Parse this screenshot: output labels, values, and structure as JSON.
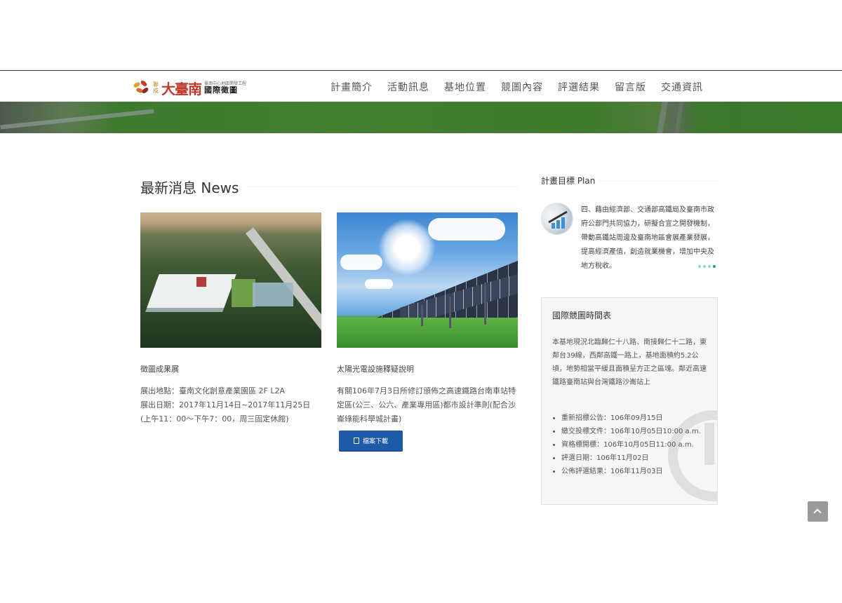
{
  "header": {
    "logo": {
      "side_text": "聯成",
      "big_text": "大臺南",
      "small_text": "臺南中心地區開發工程",
      "intl_text": "國際徵圖"
    },
    "nav": [
      "計畫簡介",
      "活動訊息",
      "基地位置",
      "競圖內容",
      "評選結果",
      "留言版",
      "交通資訊"
    ]
  },
  "news": {
    "title": "最新消息 News",
    "cards": [
      {
        "title": "徵圖成果展",
        "lines": [
          "展出地點：臺南文化創意產業園區 2F L2A",
          "展出日期：2017年11月14日~2017年11月25日",
          "(上午11：00～下午7：00，周三固定休館)"
        ]
      },
      {
        "title": "太陽光電設施釋疑說明",
        "text": "有關106年7月3日所修訂頒佈之高速鐵路台南車站特定區(公三、公六、產業專用區)都市設計準則(配合沙崙綠能科學城計畫)",
        "button": "檔案下載"
      }
    ]
  },
  "plan": {
    "title": "計畫目標 Plan",
    "text": "四、藉由經濟部、交通部高鐵局及臺南市政府公部門共同協力，研擬合宜之開發機制，帶動高鐵站周邊及臺南地區會展產業發展，提高經濟產值，創造就業機會，增加中央及地方稅收。"
  },
  "schedule": {
    "title": "國際競圖時間表",
    "description": "本基地現況北臨歸仁十八路、南接歸仁十二路，東鄰台39線，西鄰高鐵一路上，基地面積約5.2公頃，地勢相當平緩且面積呈方正之區塊。鄰近高速鐵路臺南站與台灣鐵路沙崙站上",
    "items": [
      "重新招標公告：106年09月15日",
      "繳交投標文件：106年10月05日10:00 a.m.",
      "資格標開標：106年10月05日11:00 a.m.",
      "評選日期：106年11月02日",
      "公佈評選結果：106年11月03日"
    ]
  },
  "icons": {
    "download": "document-icon",
    "back_to_top": "chevron-up-icon"
  }
}
